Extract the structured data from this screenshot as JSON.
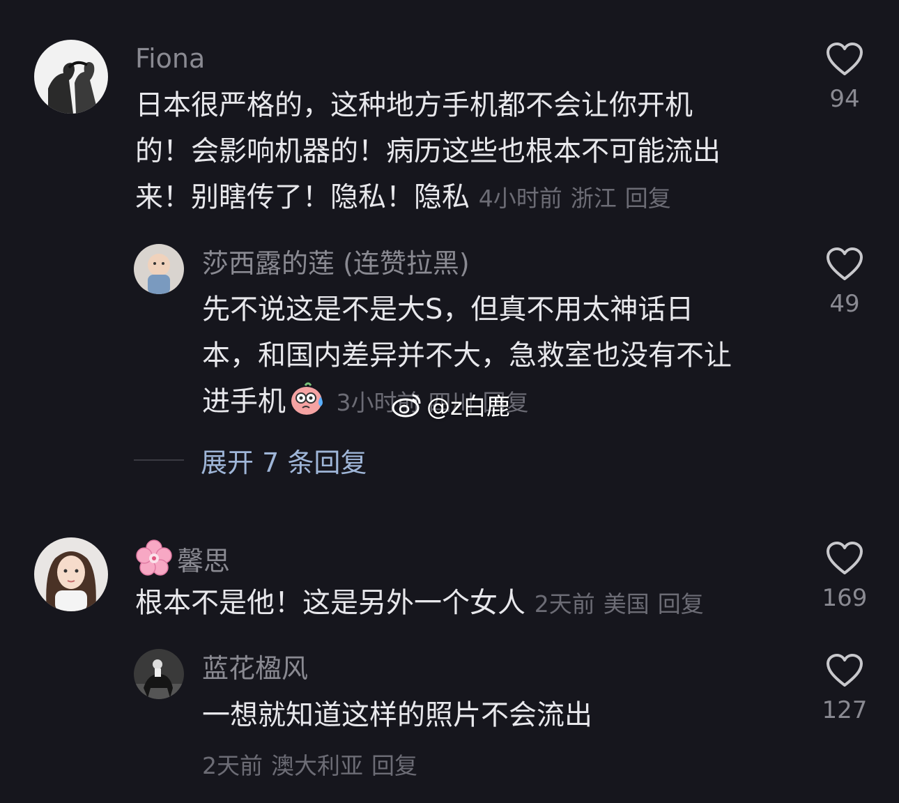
{
  "comments": [
    {
      "username": "Fiona",
      "lines": [
        "日本很严格的，这种地方手机都不会让你开机",
        "的！会影响机器的！病历这些也根本不可能流出",
        "来！别瞎传了！隐私！隐私"
      ],
      "time": "4小时前",
      "location": "浙江",
      "reply": "回复",
      "likes": "94"
    },
    {
      "username": "莎西露的莲 (连赞拉黑)",
      "lines": [
        "先不说这是不是大S，但真不用太神话日",
        "本，和国内差异并不大，急救室也没有不让",
        "进手机"
      ],
      "time": "3小时前",
      "location": "四川",
      "reply": "回复",
      "likes": "49"
    },
    {
      "username": "馨思",
      "lines": [
        "根本不是他！这是另外一个女人"
      ],
      "time": "2天前",
      "location": "美国",
      "reply": "回复",
      "likes": "169"
    },
    {
      "username": "蓝花楹风",
      "lines": [
        "一想就知道这样的照片不会流出"
      ],
      "time": "2天前",
      "location": "澳大利亚",
      "reply": "回复",
      "likes": "127"
    }
  ],
  "expand_replies": "展开 7 条回复",
  "watermark": "@z白鹿",
  "icons": {
    "like": "heart-outline-icon",
    "emoji": "sweat-face-emoji-icon",
    "flower": "cherry-blossom-icon",
    "watermark_logo": "weibo-logo-icon"
  },
  "colors": {
    "background": "#16161d",
    "text_primary": "#e8e8ec",
    "text_secondary": "#8a8a92",
    "link": "#9fb6d8"
  }
}
